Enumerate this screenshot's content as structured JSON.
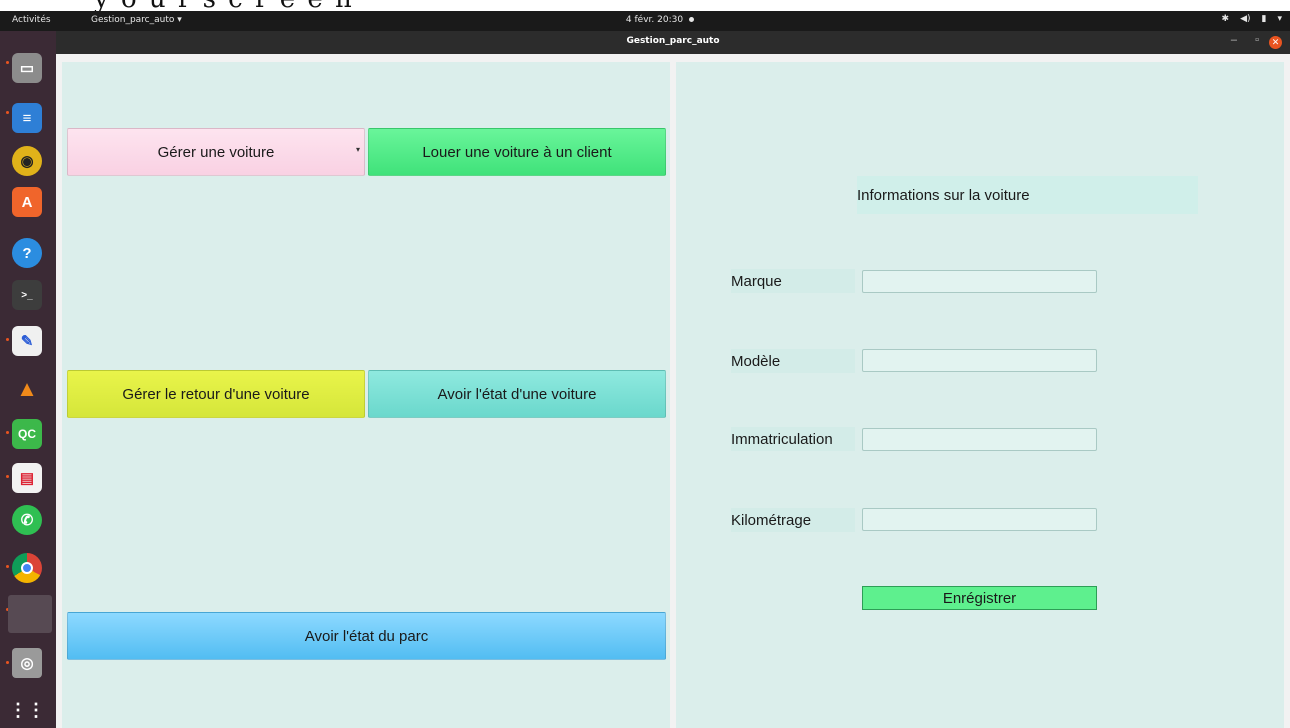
{
  "topbar": {
    "activities": "Activités",
    "app_menu": "Gestion_parc_auto ▾",
    "clock": "4 févr.  20:30"
  },
  "window": {
    "title": "Gestion_parc_auto"
  },
  "left_panel": {
    "buttons": {
      "manage_car": "Gérer une voiture",
      "rent_car": "Louer une voiture à un client",
      "manage_return": "Gérer le retour d'une voiture",
      "car_status": "Avoir l'état d'une voiture",
      "fleet_status": "Avoir l'état du parc"
    }
  },
  "right_panel": {
    "header": "Informations sur la voiture",
    "fields": {
      "brand": {
        "label": "Marque",
        "value": ""
      },
      "model": {
        "label": "Modèle",
        "value": ""
      },
      "registration": {
        "label": "Immatriculation",
        "value": ""
      },
      "mileage": {
        "label": "Kilométrage",
        "value": ""
      }
    },
    "save_label": "Enrégistrer"
  },
  "dock_icons": [
    "files-icon",
    "writer-icon",
    "rhythmbox-icon",
    "software-icon",
    "help-icon",
    "terminal-icon",
    "text-editor-icon",
    "vlc-icon",
    "qtcreator-icon",
    "document-viewer-icon",
    "whatsapp-icon",
    "chrome-icon",
    "running-app-icon",
    "disc-icon",
    "app-grid-icon"
  ],
  "colors": {
    "panel": "#dbeeeb",
    "pink_button": "#f9d1e3",
    "green_button": "#40e27a",
    "yellow_button": "#d5e63a",
    "teal_button": "#6ad8cc",
    "blue_button": "#52bdf2"
  }
}
